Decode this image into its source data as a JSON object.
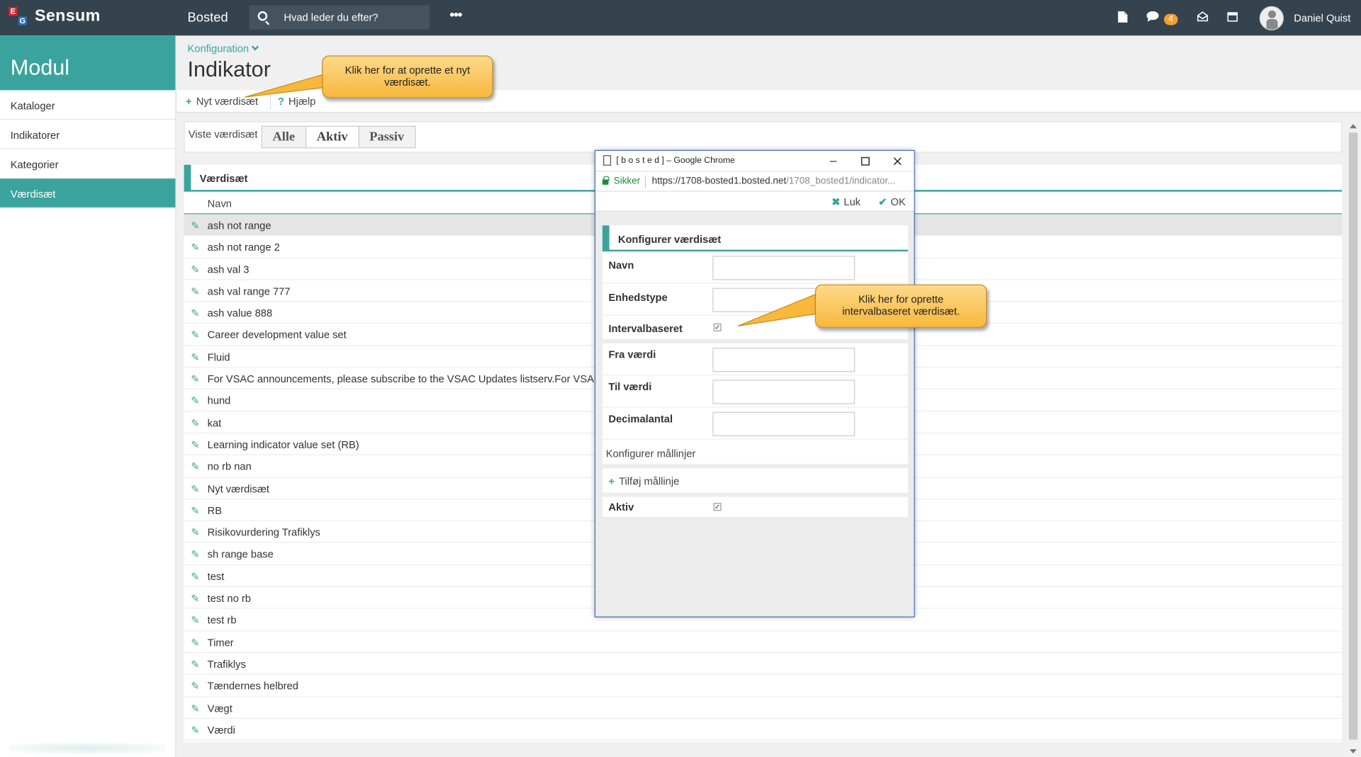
{
  "topbar": {
    "logo_letters": [
      "E",
      "G"
    ],
    "logo_text": "Sensum",
    "app_name": "Bosted",
    "search_placeholder": "Hvad leder du efter?",
    "more": "•••",
    "notification_count": "4",
    "user_name": "Daniel Quist"
  },
  "sidebar": {
    "heading": "Modul",
    "items": [
      {
        "label": "Kataloger"
      },
      {
        "label": "Indikatorer"
      },
      {
        "label": "Kategorier"
      },
      {
        "label": "Værdisæt"
      }
    ]
  },
  "main": {
    "breadcrumb": "Konfiguration",
    "title": "Indikator",
    "toolbar": {
      "new_label": "Nyt værdisæt",
      "help_label": "Hjælp"
    },
    "filter": {
      "label": "Viste værdisæt",
      "options": [
        "Alle",
        "Aktiv",
        "Passiv"
      ],
      "selected": "Aktiv"
    },
    "table": {
      "title": "Værdisæt",
      "column": "Navn",
      "rows": [
        "ash not range",
        "ash not range 2",
        "ash val 3",
        "ash val range 777",
        "ash value 888",
        "Career development value set",
        "Fluid",
        "For VSAC announcements, please subscribe to the VSAC Updates listserv.For VSAC ar",
        "hund",
        "kat",
        "Learning indicator value set (RB)",
        "no rb nan",
        "Nyt værdisæt",
        "RB",
        "Risikovurdering Trafiklys",
        "sh range base",
        "test",
        "test no rb",
        "test rb",
        "Timer",
        "Trafiklys",
        "Tændernes helbred",
        "Vægt",
        "Værdi"
      ]
    }
  },
  "callouts": {
    "new_set": "Klik her for at oprette et nyt værdisæt.",
    "interval": "Klik her for oprette intervalbaseret værdisæt."
  },
  "popup": {
    "window_title": "[ b o s t e d ] – Google Chrome",
    "secure_label": "Sikker",
    "url_main": "https://1708-bosted1.bosted.net",
    "url_rest": "/1708_bosted1/indicator...",
    "close_label": "Luk",
    "ok_label": "OK",
    "form": {
      "title": "Konfigurer værdisæt",
      "name_label": "Navn",
      "unit_label": "Enhedstype",
      "interval_label": "Intervalbaseret",
      "from_label": "Fra værdi",
      "to_label": "Til værdi",
      "decimals_label": "Decimalantal",
      "targets_heading": "Konfigurer mållinjer",
      "add_target_label": "Tilføj mållinje",
      "active_label": "Aktiv"
    }
  },
  "colors": {
    "teal": "#3aa39d",
    "topbar": "#34434e",
    "callout": "#f8b83c",
    "logo_red": "#d9262e",
    "logo_blue": "#2d6db5"
  }
}
